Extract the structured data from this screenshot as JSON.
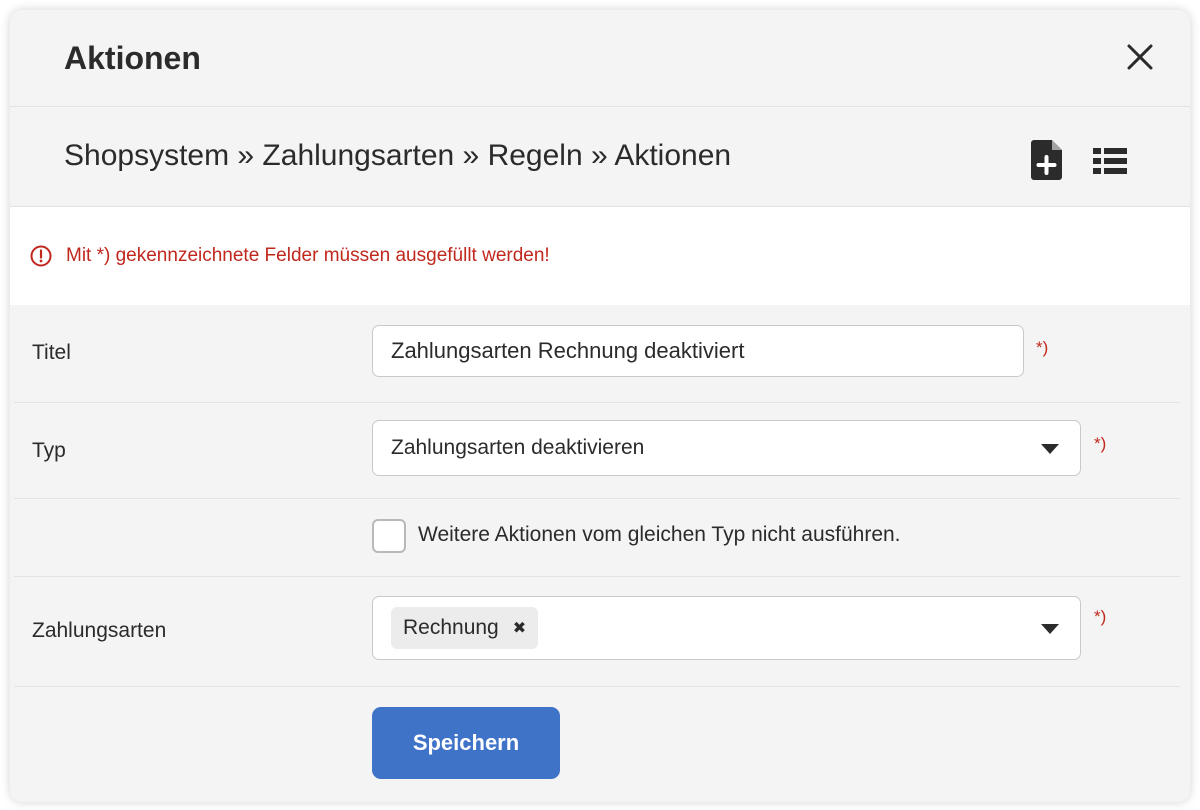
{
  "dialog": {
    "title": "Aktionen",
    "breadcrumb": "Shopsystem » Zahlungsarten » Regeln » Aktionen"
  },
  "notice": {
    "text": "Mit *) gekennzeichnete Felder müssen ausgefüllt werden!"
  },
  "form": {
    "required_marker": "*)",
    "title": {
      "label": "Titel",
      "value": "Zahlungsarten Rechnung deaktiviert"
    },
    "type": {
      "label": "Typ",
      "selected": "Zahlungsarten deaktivieren"
    },
    "checkbox": {
      "label": "Weitere Aktionen vom gleichen Typ nicht ausführen.",
      "checked": false
    },
    "payment_methods": {
      "label": "Zahlungsarten",
      "tags": [
        "Rechnung"
      ]
    },
    "save_label": "Speichern"
  },
  "icons": {
    "close": "close-icon",
    "new_document": "file-plus-icon",
    "list": "list-icon",
    "alert": "alert-circle-icon",
    "caret": "caret-down-icon"
  },
  "colors": {
    "primary": "#3f73c8",
    "error": "#c0281e",
    "background": "#f4f4f4"
  }
}
